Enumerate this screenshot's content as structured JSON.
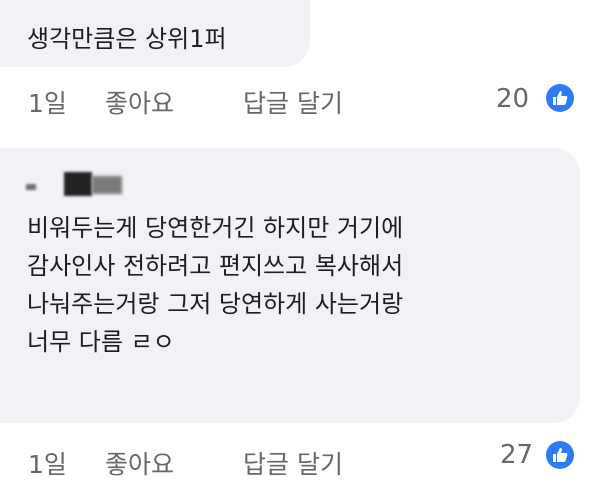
{
  "comments": [
    {
      "text_lines": [
        "생각만큼은 상위1퍼"
      ],
      "time": "1일",
      "like_label": "좋아요",
      "reply_label": "답글 달기",
      "reaction_count": "20",
      "reaction_icon": "thumbs-up-icon"
    },
    {
      "text_lines": [
        "비워두는게 당연한거긴 하지만 거기에",
        "감사인사 전하려고 편지쓰고 복사해서",
        "나눠주는거랑 그저 당연하게 사는거랑",
        "너무 다름 ㄹㅇ"
      ],
      "time": "1일",
      "like_label": "좋아요",
      "reply_label": "답글 달기",
      "reaction_count": "27",
      "reaction_icon": "thumbs-up-icon"
    }
  ],
  "colors": {
    "bubble": "#f0f2f5",
    "text": "#1c1e21",
    "meta": "#65676b",
    "like_blue": "#2e7bf6"
  }
}
